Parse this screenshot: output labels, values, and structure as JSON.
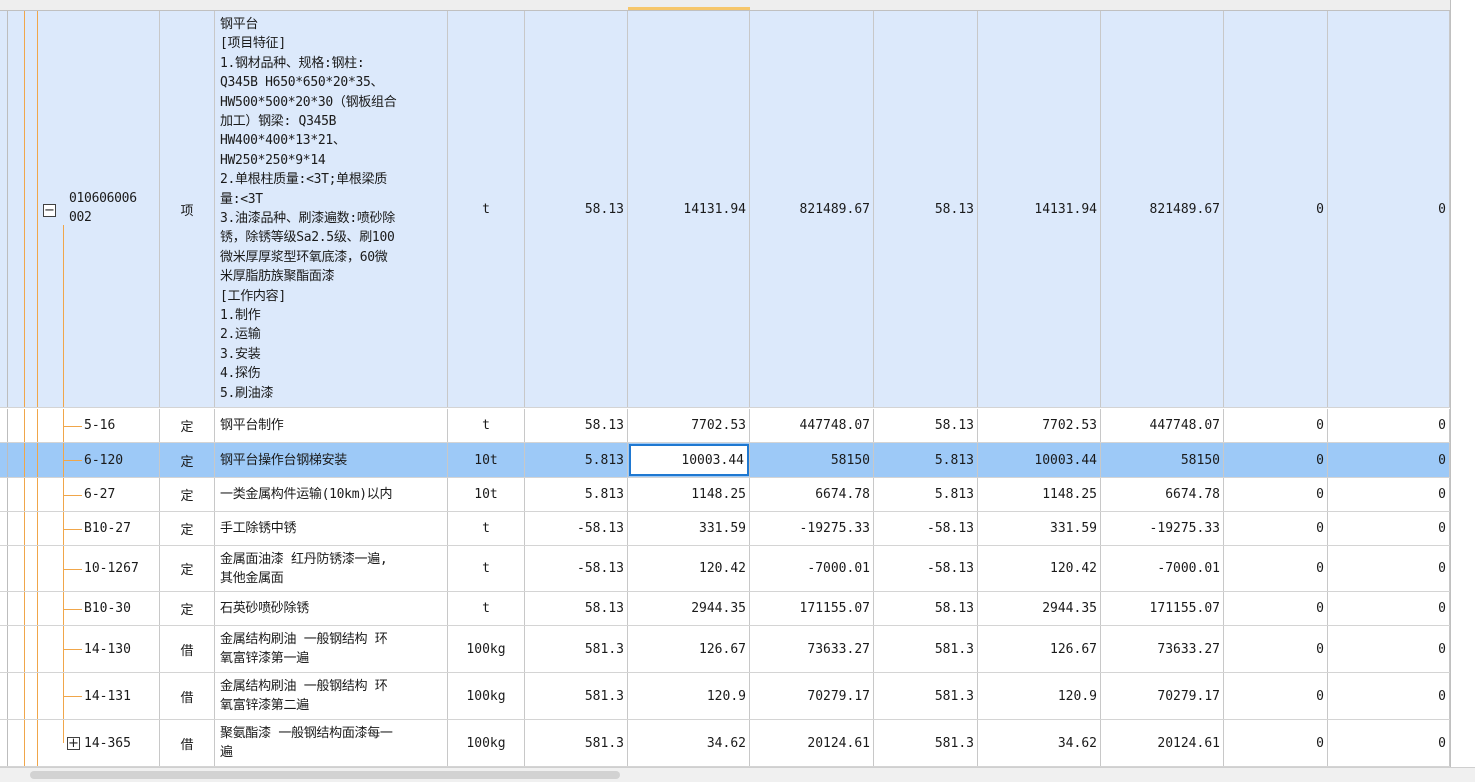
{
  "table": {
    "rows": [
      {
        "code": "010606006\n002",
        "type": "项",
        "name": "钢平台\n[项目特征]\n1.钢材品种、规格:钢柱:\nQ345B H650*650*20*35、\nHW500*500*20*30（钢板组合\n加工）钢梁: Q345B\nHW400*400*13*21、\nHW250*250*9*14\n2.单根柱质量:<3T;单根梁质\n量:<3T\n3.油漆品种、刷漆遍数:喷砂除\n锈，除锈等级Sa2.5级、刷100\n微米厚厚浆型环氧底漆，60微\n米厚脂肪族聚酯面漆\n[工作内容]\n1.制作\n2.运输\n3.安装\n4.探伤\n5.刷油漆",
        "unit": "t",
        "qty": "58.13",
        "price": "14131.94",
        "total": "821489.67",
        "qty2": "58.13",
        "price2": "14131.94",
        "total2": "821489.67",
        "diff1": "0",
        "diff2": "0",
        "expander": "−"
      },
      {
        "code": "5-16",
        "type": "定",
        "name": "钢平台制作",
        "unit": "t",
        "qty": "58.13",
        "price": "7702.53",
        "total": "447748.07",
        "qty2": "58.13",
        "price2": "7702.53",
        "total2": "447748.07",
        "diff1": "0",
        "diff2": "0"
      },
      {
        "code": "6-120",
        "type": "定",
        "name": "钢平台操作台钢梯安装",
        "unit": "10t",
        "qty": "5.813",
        "price": "10003.44",
        "total": "58150",
        "qty2": "5.813",
        "price2": "10003.44",
        "total2": "58150",
        "diff1": "0",
        "diff2": "0"
      },
      {
        "code": "6-27",
        "type": "定",
        "name": "一类金属构件运输(10km)以内",
        "unit": "10t",
        "qty": "5.813",
        "price": "1148.25",
        "total": "6674.78",
        "qty2": "5.813",
        "price2": "1148.25",
        "total2": "6674.78",
        "diff1": "0",
        "diff2": "0"
      },
      {
        "code": "B10-27",
        "type": "定",
        "name": "手工除锈中锈",
        "unit": "t",
        "qty": "-58.13",
        "price": "331.59",
        "total": "-19275.33",
        "qty2": "-58.13",
        "price2": "331.59",
        "total2": "-19275.33",
        "diff1": "0",
        "diff2": "0"
      },
      {
        "code": "10-1267",
        "type": "定",
        "name": "金属面油漆 红丹防锈漆一遍,\n其他金属面",
        "unit": "t",
        "qty": "-58.13",
        "price": "120.42",
        "total": "-7000.01",
        "qty2": "-58.13",
        "price2": "120.42",
        "total2": "-7000.01",
        "diff1": "0",
        "diff2": "0"
      },
      {
        "code": "B10-30",
        "type": "定",
        "name": "石英砂喷砂除锈",
        "unit": "t",
        "qty": "58.13",
        "price": "2944.35",
        "total": "171155.07",
        "qty2": "58.13",
        "price2": "2944.35",
        "total2": "171155.07",
        "diff1": "0",
        "diff2": "0"
      },
      {
        "code": "14-130",
        "type": "借",
        "name": "金属结构刷油 一般钢结构 环\n氧富锌漆第一遍",
        "unit": "100kg",
        "qty": "581.3",
        "price": "126.67",
        "total": "73633.27",
        "qty2": "581.3",
        "price2": "126.67",
        "total2": "73633.27",
        "diff1": "0",
        "diff2": "0"
      },
      {
        "code": "14-131",
        "type": "借",
        "name": "金属结构刷油 一般钢结构 环\n氧富锌漆第二遍",
        "unit": "100kg",
        "qty": "581.3",
        "price": "120.9",
        "total": "70279.17",
        "qty2": "581.3",
        "price2": "120.9",
        "total2": "70279.17",
        "diff1": "0",
        "diff2": "0"
      },
      {
        "code": "14-365",
        "type": "借",
        "name": "聚氨酯漆 一般钢结构面漆每一\n遍",
        "unit": "100kg",
        "qty": "581.3",
        "price": "34.62",
        "total": "20124.61",
        "qty2": "581.3",
        "price2": "34.62",
        "total2": "20124.61",
        "diff1": "0",
        "diff2": "0",
        "expander": "+"
      }
    ]
  },
  "colors": {
    "selected_item_bg": "#dce9fb",
    "selected_row_bg": "#9dc9f7",
    "tree_line": "#f0a64a",
    "edit_border": "#1f78d1"
  }
}
